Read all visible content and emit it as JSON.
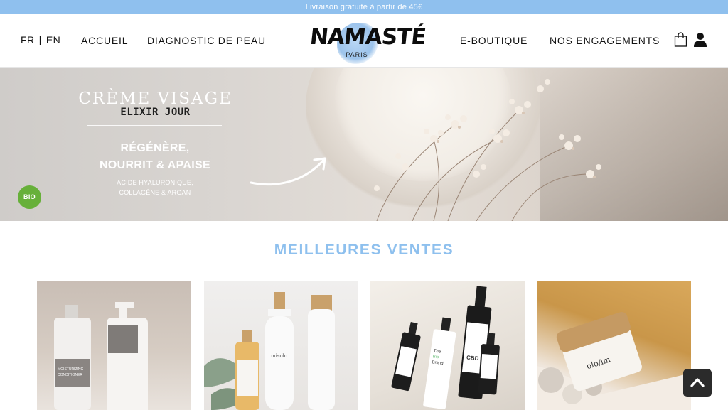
{
  "topbar": {
    "text": "Livraison gratuite à partir de 45€"
  },
  "header": {
    "lang": {
      "fr": "FR",
      "sep": "|",
      "en": "EN"
    },
    "nav_left": [
      "ACCUEIL",
      "DIAGNOSTIC DE PEAU"
    ],
    "logo": {
      "word": "NAMASTÉ",
      "sub": "PARIS"
    },
    "nav_right": [
      "E-BOUTIQUE",
      "NOS ENGAGEMENTS"
    ],
    "icons": [
      "shopping-bag-icon",
      "user-icon"
    ]
  },
  "hero": {
    "title": "CRÈME VISAGE",
    "script": "ELIXIR JOUR",
    "claim_line1": "RÉGÉNÈRE,",
    "claim_line2": "NOURRIT & APAISE",
    "ingredients_line1": "ACIDE HYALURONIQUE,",
    "ingredients_line2": "COLLAGÈNE & ARGAN",
    "badge": "BIO"
  },
  "section": {
    "title": "MEILLEURES VENTES"
  },
  "products": [
    {
      "image": "moisturizing-conditioner-bottles",
      "label1": "MOISTURIZING",
      "label2": "CONDITIONER"
    },
    {
      "image": "misolo-bottles",
      "brand": "misolo"
    },
    {
      "image": "cbd-oil-bottles",
      "label1": "The",
      "label2": "Bio",
      "label3": "Brand",
      "label4": "CBD"
    },
    {
      "image": "olo-jar",
      "brand": "olo/im"
    }
  ],
  "colors": {
    "accent": "#8ec0ee",
    "topbar": "#8fc0ee",
    "bio_green": "#67b03a",
    "dark": "#2b2b2b"
  }
}
